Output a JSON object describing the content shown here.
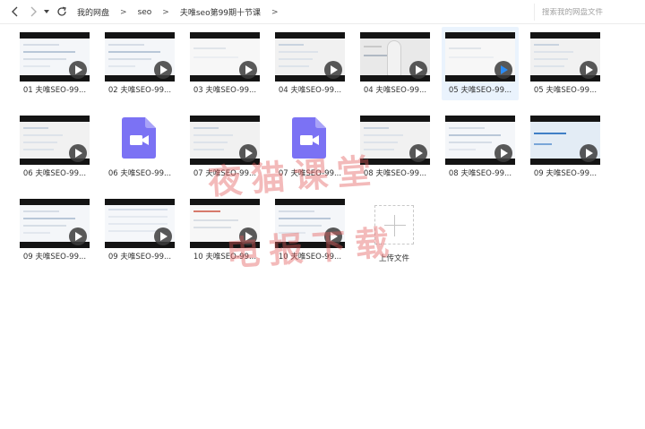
{
  "toolbar": {
    "back_icon": "chevron-left-icon",
    "forward_icon": "chevron-right-icon",
    "history_icon": "caret-down-icon",
    "refresh_icon": "refresh-icon"
  },
  "breadcrumb": {
    "items": [
      "我的网盘",
      "seo",
      "夫唯seo第99期十节课"
    ],
    "separator": ">"
  },
  "search": {
    "placeholder": "搜索我的网盘文件"
  },
  "files": [
    {
      "label": "01 夫唯SEO-99...",
      "kind": "video",
      "theme": "browser"
    },
    {
      "label": "02 夫唯SEO-99...",
      "kind": "video",
      "theme": "browser"
    },
    {
      "label": "03 夫唯SEO-99...",
      "kind": "video",
      "theme": "slide-light"
    },
    {
      "label": "04 夫唯SEO-99...",
      "kind": "video",
      "theme": "slide"
    },
    {
      "label": "04 夫唯SEO-99...",
      "kind": "video",
      "theme": "person"
    },
    {
      "label": "05 夫唯SEO-99...",
      "kind": "video",
      "theme": "slide-light",
      "selected": true
    },
    {
      "label": "05 夫唯SEO-99...",
      "kind": "video",
      "theme": "slide"
    },
    {
      "label": "06 夫唯SEO-99...",
      "kind": "video",
      "theme": "slide"
    },
    {
      "label": "06 夫唯SEO-99...",
      "kind": "file",
      "theme": "doc"
    },
    {
      "label": "07 夫唯SEO-99...",
      "kind": "video",
      "theme": "slide"
    },
    {
      "label": "07 夫唯SEO-99...",
      "kind": "file",
      "theme": "doc"
    },
    {
      "label": "08 夫唯SEO-99...",
      "kind": "video",
      "theme": "slide"
    },
    {
      "label": "08 夫唯SEO-99...",
      "kind": "video",
      "theme": "browser"
    },
    {
      "label": "09 夫唯SEO-99...",
      "kind": "video",
      "theme": "logo"
    },
    {
      "label": "09 夫唯SEO-99...",
      "kind": "video",
      "theme": "browser"
    },
    {
      "label": "09 夫唯SEO-99...",
      "kind": "video",
      "theme": "sheet"
    },
    {
      "label": "10 夫唯SEO-99...",
      "kind": "video",
      "theme": "https"
    },
    {
      "label": "10 夫唯SEO-99...",
      "kind": "video",
      "theme": "browser"
    }
  ],
  "upload": {
    "label": "上传文件",
    "icon": "plus-icon"
  },
  "watermark": {
    "line1": "夜猫课堂",
    "line2": "电报下载"
  },
  "colors": {
    "selected_bg": "#eaf3fd",
    "doc_icon": "#7b72f4",
    "play_active": "#2c8cf4",
    "watermark": "#e25a5a"
  }
}
